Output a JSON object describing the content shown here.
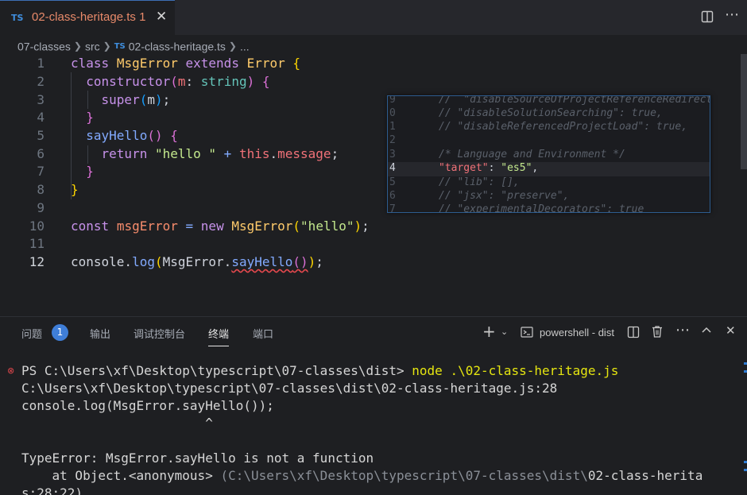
{
  "tab": {
    "lang_badge": "TS",
    "filename": "02-class-heritage.ts",
    "problems": "1",
    "close": "✕"
  },
  "toolbar": {
    "split_icon": "split-editor-icon",
    "more_icon": "more-actions-icon"
  },
  "breadcrumb": {
    "items": [
      "07-classes",
      "src",
      "02-class-heritage.ts",
      "..."
    ]
  },
  "editor": {
    "line_numbers": [
      "1",
      "2",
      "3",
      "4",
      "5",
      "6",
      "7",
      "8",
      "9",
      "10",
      "11",
      "12"
    ],
    "current_line": "12"
  },
  "peek": {
    "line_numbers": [
      "9",
      "0",
      "1",
      "2",
      "3",
      "4",
      "5",
      "6",
      "7"
    ],
    "lines": [
      "//  \"disableSourceOfProjectReferenceRedirect",
      "// \"disableSolutionSearching\": true,",
      "// \"disableReferencedProjectLoad\": true,",
      "",
      "/* Language and Environment */",
      "\"target\": \"es5\",",
      "// \"lib\": [],",
      "// \"jsx\": \"preserve\",",
      "// \"experimentalDecorators\": true"
    ]
  },
  "panel": {
    "tabs": [
      "问题",
      "输出",
      "调试控制台",
      "终端",
      "端口"
    ],
    "problems_count": "1",
    "active_tab": "终端",
    "shell_label": "powershell - dist"
  },
  "terminal": {
    "prompt": "PS C:\\Users\\xf\\Desktop\\typescript\\07-classes\\dist> ",
    "command": "node .\\02-class-heritage.js",
    "lines": [
      "C:\\Users\\xf\\Desktop\\typescript\\07-classes\\dist\\02-class-heritage.js:28",
      "console.log(MsgError.sayHello());",
      "                        ^",
      "",
      "TypeError: MsgError.sayHello is not a function"
    ],
    "stack_at": "    at Object.<anonymous> ",
    "stack_path_dim": "(C:\\Users\\xf\\Desktop\\typescript\\07-classes\\dist\\",
    "stack_path_file": "02-class-herita",
    "stack_tail": "s:28:22)"
  },
  "colors": {
    "accent": "#3f7ed8",
    "error": "#e5484d",
    "command": "#e5e510"
  }
}
